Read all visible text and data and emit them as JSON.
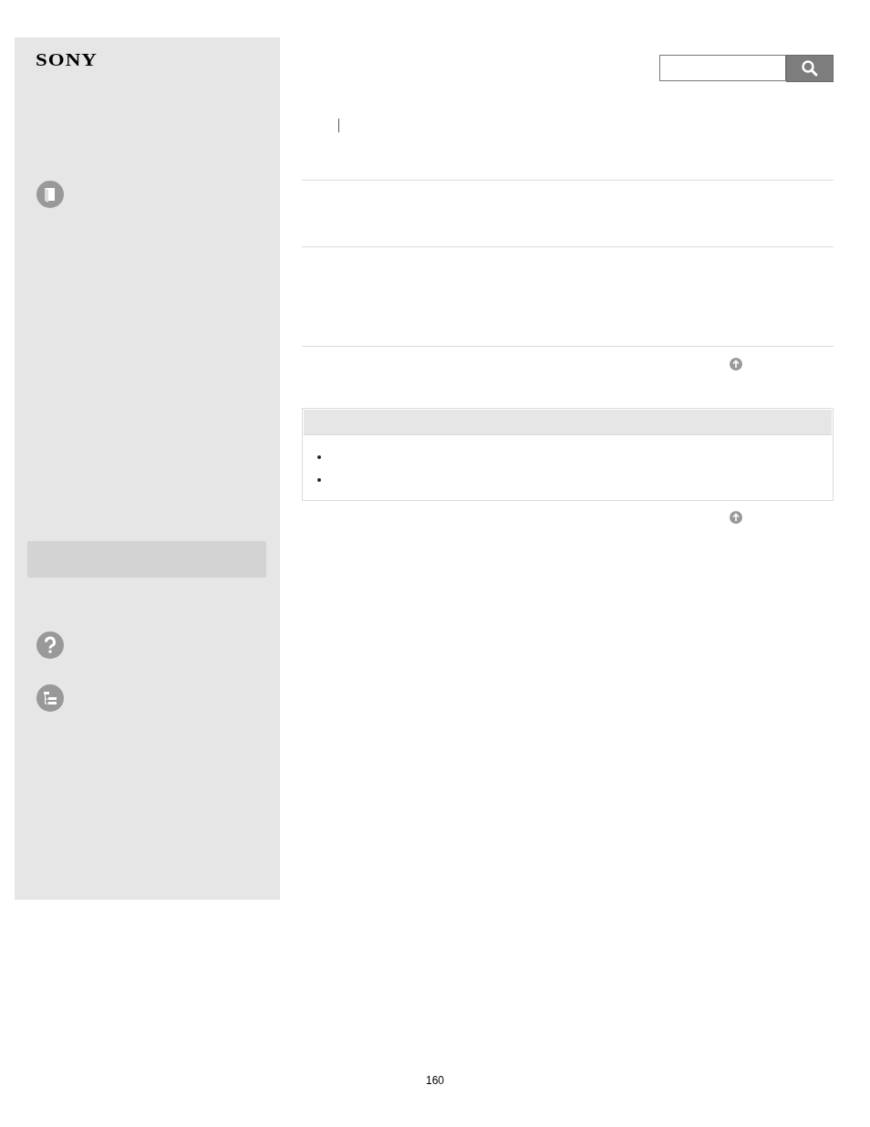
{
  "logo": "SONY",
  "page_number": "160"
}
